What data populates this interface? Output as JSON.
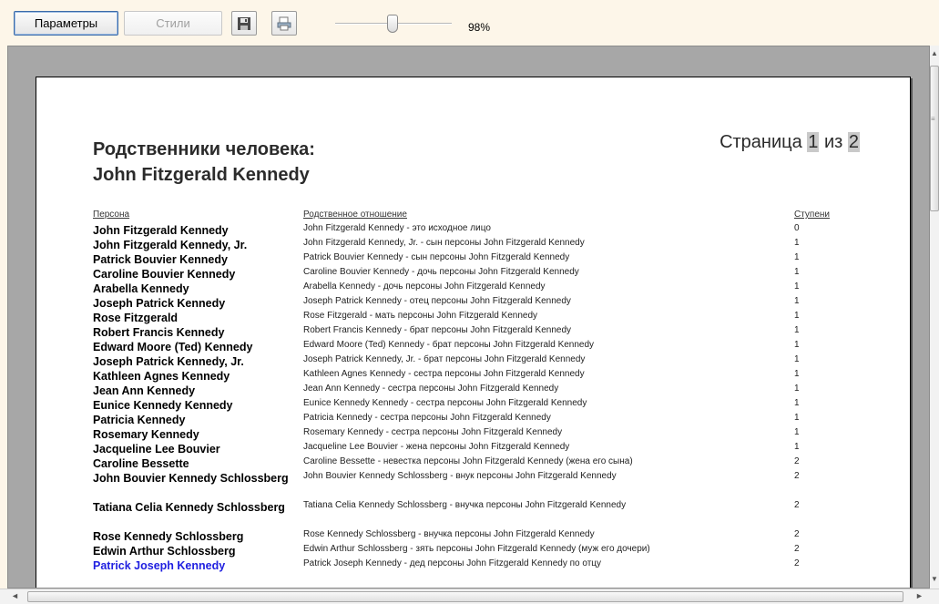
{
  "toolbar": {
    "params_label": "Параметры",
    "styles_label": "Стили",
    "zoom_value": 98,
    "zoom_label": "98%"
  },
  "report": {
    "title_line1": "Родственники человека:",
    "title_line2": "John Fitzgerald Kennedy",
    "page_prefix": "Страница",
    "page_current": "1",
    "page_sep": "из",
    "page_total": "2",
    "headers": {
      "person": "Персона",
      "relation": "Родственное отношение",
      "degree": "Ступени"
    },
    "rows": [
      {
        "person": "John Fitzgerald Kennedy",
        "relation": "John Fitzgerald Kennedy - это исходное лицо",
        "degree": "0"
      },
      {
        "person": "John Fitzgerald Kennedy, Jr.",
        "relation": "John Fitzgerald Kennedy, Jr. - сын персоны John Fitzgerald Kennedy",
        "degree": "1"
      },
      {
        "person": "Patrick Bouvier Kennedy",
        "relation": "Patrick Bouvier Kennedy - сын персоны John Fitzgerald Kennedy",
        "degree": "1"
      },
      {
        "person": "Caroline Bouvier Kennedy",
        "relation": "Caroline Bouvier Kennedy - дочь персоны John Fitzgerald Kennedy",
        "degree": "1"
      },
      {
        "person": "Arabella Kennedy",
        "relation": "Arabella Kennedy - дочь персоны John Fitzgerald Kennedy",
        "degree": "1"
      },
      {
        "person": "Joseph Patrick Kennedy",
        "relation": "Joseph Patrick Kennedy - отец персоны John Fitzgerald Kennedy",
        "degree": "1"
      },
      {
        "person": "Rose Fitzgerald",
        "relation": "Rose Fitzgerald - мать персоны John Fitzgerald Kennedy",
        "degree": "1"
      },
      {
        "person": "Robert Francis Kennedy",
        "relation": "Robert Francis Kennedy - брат персоны John Fitzgerald Kennedy",
        "degree": "1"
      },
      {
        "person": "Edward Moore (Ted) Kennedy",
        "relation": "Edward Moore (Ted) Kennedy - брат персоны John Fitzgerald Kennedy",
        "degree": "1"
      },
      {
        "person": "Joseph Patrick Kennedy, Jr.",
        "relation": "Joseph Patrick Kennedy, Jr. - брат персоны John Fitzgerald Kennedy",
        "degree": "1"
      },
      {
        "person": "Kathleen Agnes Kennedy",
        "relation": "Kathleen Agnes Kennedy - сестра персоны John Fitzgerald Kennedy",
        "degree": "1"
      },
      {
        "person": "Jean Ann Kennedy",
        "relation": "Jean Ann Kennedy - сестра персоны John Fitzgerald Kennedy",
        "degree": "1"
      },
      {
        "person": "Eunice Kennedy Kennedy",
        "relation": "Eunice Kennedy Kennedy - сестра персоны John Fitzgerald Kennedy",
        "degree": "1"
      },
      {
        "person": "Patricia Kennedy",
        "relation": "Patricia Kennedy - сестра персоны John Fitzgerald Kennedy",
        "degree": "1"
      },
      {
        "person": "Rosemary Kennedy",
        "relation": "Rosemary Kennedy - сестра персоны John Fitzgerald Kennedy",
        "degree": "1"
      },
      {
        "person": "Jacqueline Lee Bouvier",
        "relation": "Jacqueline Lee Bouvier - жена персоны John Fitzgerald Kennedy",
        "degree": "1"
      },
      {
        "person": "Caroline Bessette",
        "relation": "Caroline Bessette - невестка персоны John Fitzgerald Kennedy (жена его сына)",
        "degree": "2"
      },
      {
        "person": "John Bouvier Kennedy Schlossberg",
        "relation": "John Bouvier Kennedy Schlossberg - внук персоны John Fitzgerald Kennedy",
        "degree": "2"
      },
      {
        "person": "Tatiana Celia Kennedy Schlossberg",
        "relation": "Tatiana Celia Kennedy Schlossberg - внучка персоны John Fitzgerald Kennedy",
        "degree": "2"
      },
      {
        "person": "Rose Kennedy Schlossberg",
        "relation": "Rose Kennedy Schlossberg - внучка персоны John Fitzgerald Kennedy",
        "degree": "2"
      },
      {
        "person": "Edwin Arthur Schlossberg",
        "relation": "Edwin Arthur Schlossberg - зять персоны John Fitzgerald Kennedy (муж его дочери)",
        "degree": "2"
      },
      {
        "person": "Patrick Joseph Kennedy",
        "relation": "Patrick Joseph Kennedy - дед персоны John Fitzgerald Kennedy по отцу",
        "degree": "2"
      }
    ]
  }
}
